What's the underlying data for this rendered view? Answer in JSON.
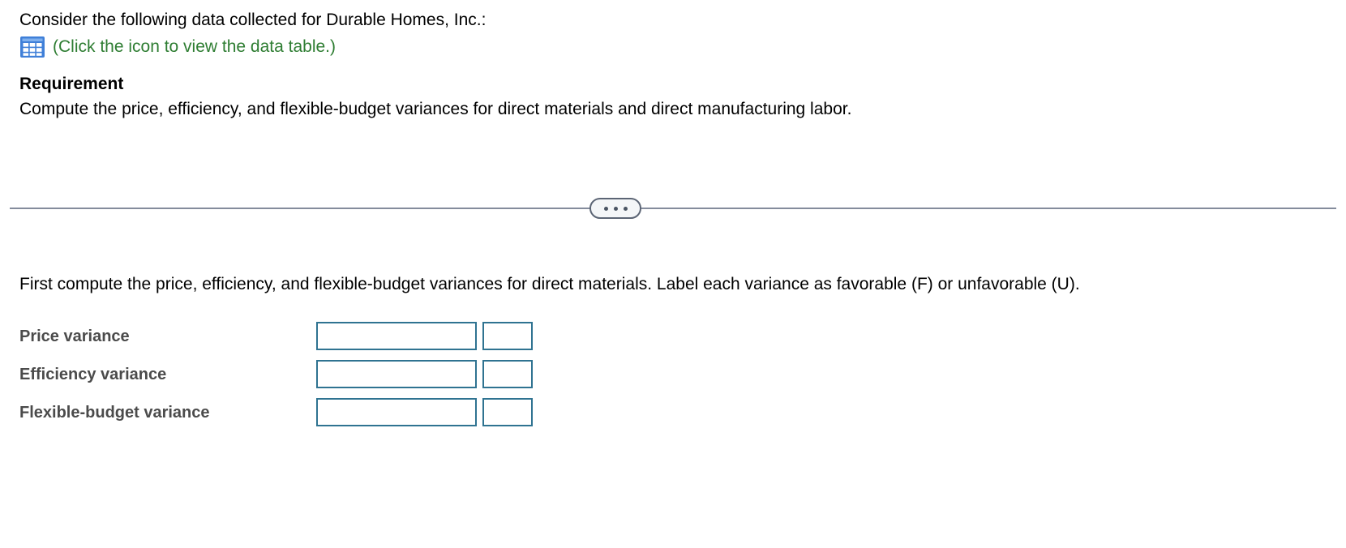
{
  "problem": {
    "intro": "Consider the following data collected for Durable Homes, Inc.:",
    "icon_name": "data-table-icon",
    "icon_caption": "(Click the icon to view the data table.)",
    "requirement_heading": "Requirement",
    "requirement_body": "Compute the price, efficiency, and flexible-budget variances for direct materials and direct manufacturing labor."
  },
  "divider": {
    "expand_label": "•••"
  },
  "answer": {
    "prompt": "First compute the price, efficiency, and flexible-budget variances for direct materials. Label each variance as favorable (F) or unfavorable (U).",
    "rows": [
      {
        "label": "Price variance",
        "amount": "",
        "flag": ""
      },
      {
        "label": "Efficiency variance",
        "amount": "",
        "flag": ""
      },
      {
        "label": "Flexible-budget variance",
        "amount": "",
        "flag": ""
      }
    ]
  },
  "colors": {
    "link_green": "#2e7d32",
    "icon_blue": "#3f7fd8",
    "field_border": "#2f7391",
    "divider_gray": "#848c9c",
    "label_gray": "#4b4b4b"
  }
}
